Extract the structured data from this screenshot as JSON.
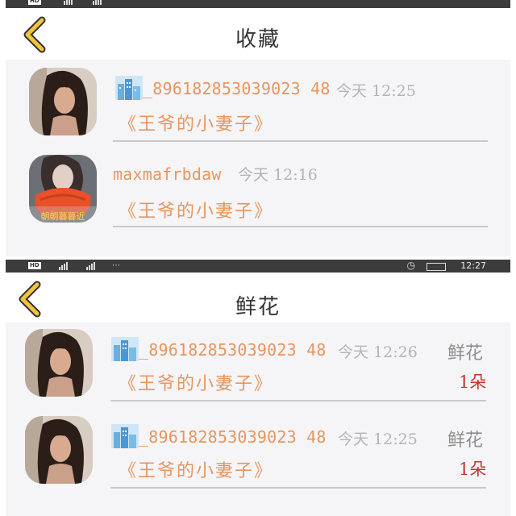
{
  "top": {
    "status_bar": {
      "net_label": "HD"
    },
    "header": {
      "title": "收藏",
      "back_icon": "chevron-left-icon"
    },
    "items": [
      {
        "username": "_896182853039023 48",
        "has_city_icon": true,
        "time": "今天  12:25",
        "book": "《王爷的小妻子》"
      },
      {
        "username": "maxmafrbdaw",
        "has_city_icon": false,
        "time": "今天  12:16",
        "book": "《王爷的小妻子》",
        "avatar_caption": "朝朝暮暮近"
      }
    ]
  },
  "bottom": {
    "status_bar": {
      "net_label": "HD",
      "clock": "12:27"
    },
    "header": {
      "title": "鲜花",
      "back_icon": "chevron-left-icon"
    },
    "items": [
      {
        "username": "_896182853039023 48",
        "has_city_icon": true,
        "time": "今天  12:26",
        "book": "《王爷的小妻子》",
        "gift_label": "鲜花",
        "gift_count": "1朵"
      },
      {
        "username": "_896182853039023 48",
        "has_city_icon": true,
        "time": "今天  12:25",
        "book": "《王爷的小妻子》",
        "gift_label": "鲜花",
        "gift_count": "1朵"
      }
    ]
  },
  "colors": {
    "accent_orange": "#e9955e",
    "back_arrow_yellow": "#f2c43a",
    "gift_count_red": "#c8332f",
    "list_background": "#f5f5f7",
    "status_bar": "#3c3c3c"
  }
}
